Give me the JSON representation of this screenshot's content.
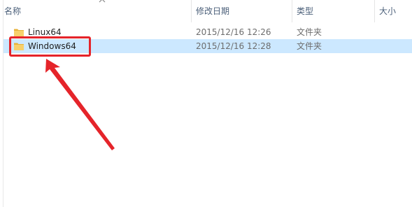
{
  "columns": {
    "name": "名称",
    "modified": "修改日期",
    "type": "类型",
    "size": "大小"
  },
  "files": [
    {
      "name": "Linux64",
      "modified": "2015/12/16 12:26",
      "type": "文件夹",
      "selected": false,
      "icon": "folder-icon"
    },
    {
      "name": "Windows64",
      "modified": "2015/12/16 12:28",
      "type": "文件夹",
      "selected": true,
      "icon": "folder-icon"
    }
  ],
  "colors": {
    "selection": "#cce8ff",
    "annotation": "#e5242a",
    "header_text": "#4c607a",
    "folder": "#f5c242"
  }
}
